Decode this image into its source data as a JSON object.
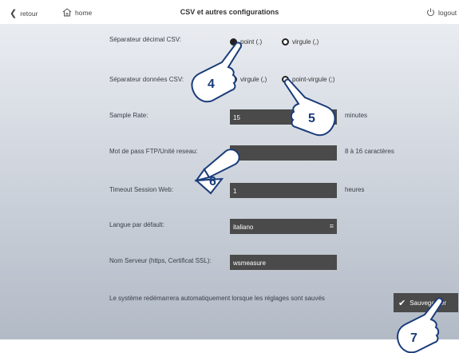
{
  "topbar": {
    "back_label": "retour",
    "home_label": "home",
    "title": "CSV et autres configurations",
    "logout_label": "logout"
  },
  "settings": {
    "decimal_sep": {
      "label": "Séparateur décimal CSV:",
      "options": [
        "point (.)",
        "virgule (,)"
      ],
      "selected": "point (.)"
    },
    "data_sep": {
      "label": "Séparateur données CSV:",
      "options": [
        "virgule (,)",
        "point-virgule (;)"
      ],
      "selected": "point-virgule (;)"
    },
    "sample_rate": {
      "label": "Sample Rate:",
      "value": "15",
      "unit": "minutes"
    },
    "ftp_password": {
      "label": "Mot de pass FTP/Unité reseau:",
      "value": "",
      "unit": "8 à 16 caractères"
    },
    "timeout": {
      "label": "Timeout Session Web:",
      "value": "1",
      "unit": "heures"
    },
    "language": {
      "label": "Langue par défault:",
      "value": "italiano"
    },
    "server_name": {
      "label": "Nom Serveur (https, Certificat SSL):",
      "value": "wsmeasure"
    },
    "restart_note": "Le système redémarrera automatiquement lorsque les réglages sont sauvés"
  },
  "save_label": "Sauvegarder",
  "callouts": [
    "4",
    "5",
    "6",
    "7"
  ],
  "colors": {
    "field_bg": "#4a4a4a",
    "panel_top": "#e9ecf1",
    "panel_bottom": "#b2bac6",
    "callout_text": "#1a3c7a"
  }
}
